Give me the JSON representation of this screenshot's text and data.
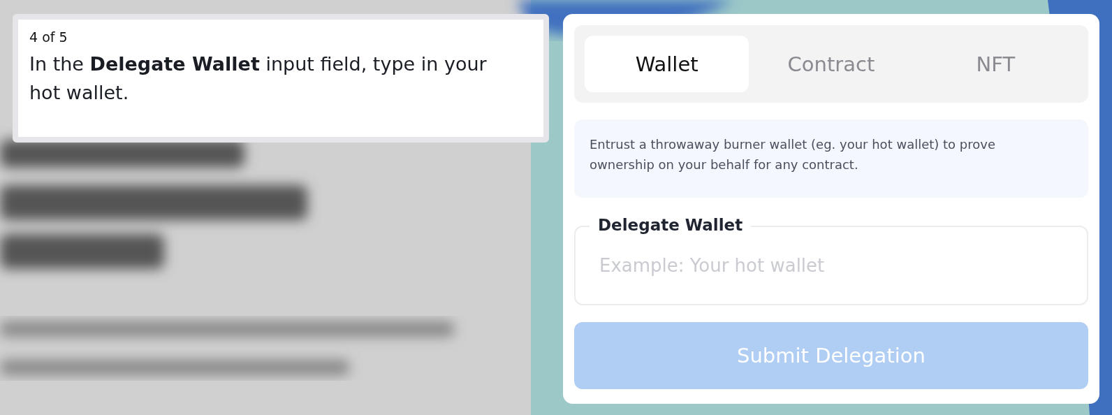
{
  "tour_step": {
    "counter": "4 of 5",
    "instruction": "In the **Delegate Wallet** input field, type in your hot wallet."
  },
  "tabs": [
    {
      "label": "Wallet",
      "selected": true
    },
    {
      "label": "Contract",
      "selected": false
    },
    {
      "label": "NFT",
      "selected": false
    }
  ],
  "info": "Entrust a throwaway burner wallet (eg. your hot wallet) to prove ownership on your behalf for any contract.",
  "field": {
    "label": "Delegate Wallet",
    "placeholder": "Example: Your hot wallet"
  },
  "submit": {
    "label": "Submit Delegation",
    "disabled": true
  }
}
